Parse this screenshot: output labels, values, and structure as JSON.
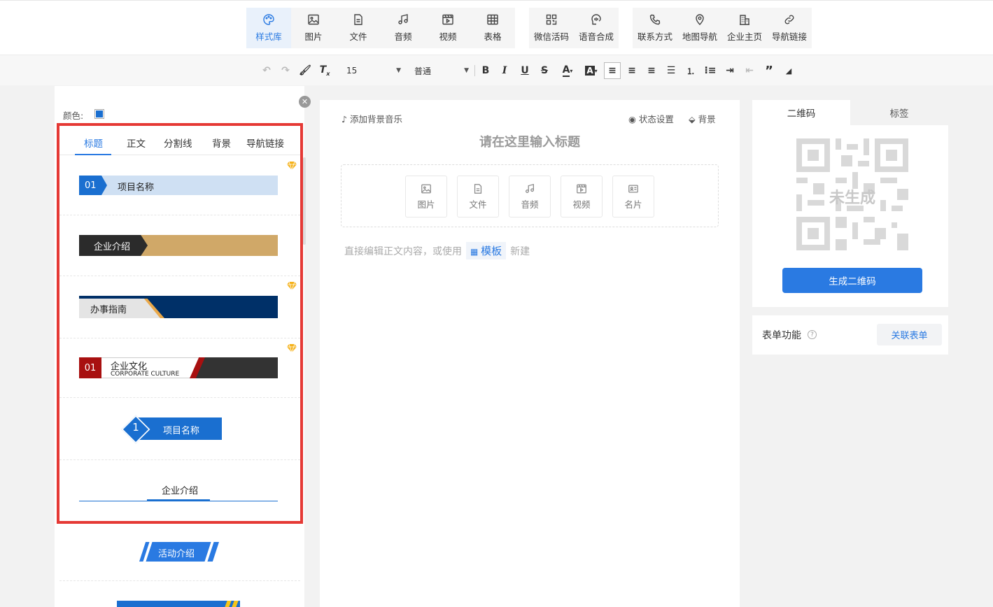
{
  "toolbar": {
    "groups": [
      [
        {
          "label": "样式库",
          "icon": "palette-icon",
          "active": true
        },
        {
          "label": "图片",
          "icon": "image-icon"
        },
        {
          "label": "文件",
          "icon": "file-icon"
        },
        {
          "label": "音频",
          "icon": "music-icon"
        },
        {
          "label": "视频",
          "icon": "video-icon"
        },
        {
          "label": "表格",
          "icon": "table-icon"
        }
      ],
      [
        {
          "label": "微信活码",
          "icon": "qrcode-icon"
        },
        {
          "label": "语音合成",
          "icon": "voice-synthesis-icon"
        }
      ],
      [
        {
          "label": "联系方式",
          "icon": "phone-icon"
        },
        {
          "label": "地图导航",
          "icon": "map-pin-icon"
        },
        {
          "label": "企业主页",
          "icon": "building-icon"
        },
        {
          "label": "导航链接",
          "icon": "link-icon"
        }
      ]
    ]
  },
  "format": {
    "font_size": "15",
    "paragraph": "普通",
    "undo_icon": "undo-icon",
    "redo_icon": "redo-icon"
  },
  "left_panel": {
    "color_label": "颜色:",
    "color_value": "#1a6fd0",
    "tabs": [
      "标题",
      "正文",
      "分割线",
      "背景",
      "导航链接"
    ],
    "active_tab": "标题",
    "items": {
      "s1_num": "01",
      "s1_text": "项目名称",
      "s2_text": "企业介绍",
      "s3_text": "办事指南",
      "s4_num": "01",
      "s4_title": "企业文化",
      "s4_sub": "CORPORATE CULTURE",
      "s5_num": "1",
      "s5_text": "项目名称",
      "s6_text": "企业介绍",
      "s7_text": "活动介绍"
    },
    "brand_colors": {
      "blue": "#1a6fd0",
      "gold": "#d0a868",
      "navy": "#003068",
      "red": "#a81010",
      "dark": "#333333"
    }
  },
  "editor": {
    "bg_music": "添加背景音乐",
    "status_settings": "状态设置",
    "background": "背景",
    "title_placeholder": "请在这里输入标题",
    "media": [
      "图片",
      "文件",
      "音频",
      "视频",
      "名片"
    ],
    "body_hint_prefix": "直接编辑正文内容，或使用",
    "template_label": "模板",
    "body_hint_suffix": "新建"
  },
  "right_panel": {
    "tabs": [
      "二维码",
      "标签"
    ],
    "qr_status": "未生成",
    "generate_button": "生成二维码",
    "form_label": "表单功能",
    "link_form_button": "关联表单"
  }
}
